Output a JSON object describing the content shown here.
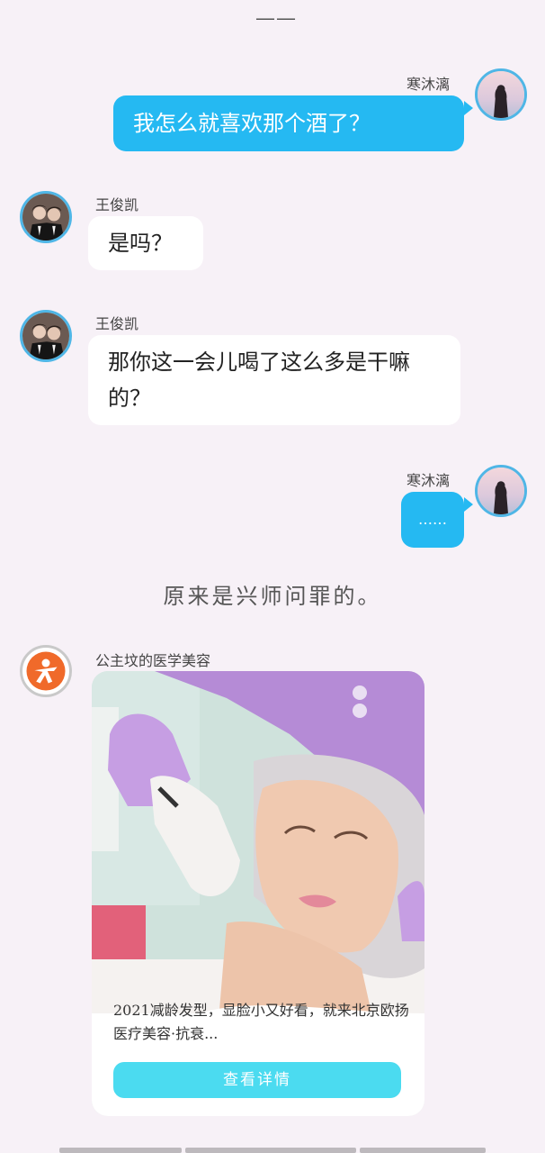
{
  "top_marker": "——",
  "messages": [
    {
      "sender": "寒沐漓",
      "text": "我怎么就喜欢那个酒了？"
    },
    {
      "sender": "王俊凯",
      "text": "是吗？"
    },
    {
      "sender": "王俊凯",
      "text": "那你这一会儿喝了这么多是干嘛的？"
    },
    {
      "sender": "寒沐漓",
      "text": "……"
    }
  ],
  "narration": "原来是兴师问罪的。",
  "ad": {
    "sender": "公主坟的医学美容",
    "text": "2021减龄发型，显脸小又好看，就来北京欧扬医疗美容·抗衰...",
    "button_label": "查看详情"
  },
  "colors": {
    "my_bubble": "#25b9f2",
    "avatar_border": "#4fb6e6",
    "ad_button": "#4bdbf0",
    "ad_logo": "#f06a2a"
  }
}
